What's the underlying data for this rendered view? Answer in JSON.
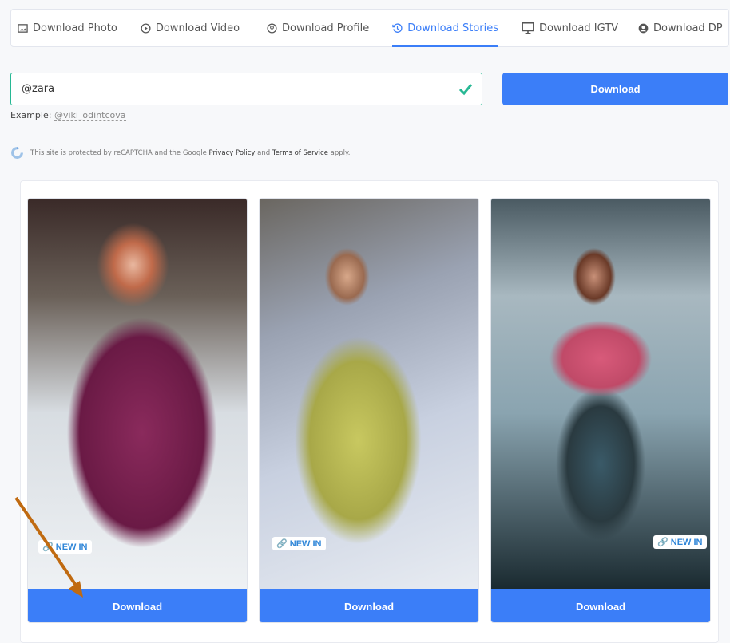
{
  "tabs": [
    {
      "label": "Download Photo",
      "icon": "image-icon",
      "active": false
    },
    {
      "label": "Download Video",
      "icon": "play-circle-icon",
      "active": false
    },
    {
      "label": "Download Profile",
      "icon": "user-circle-icon",
      "active": false
    },
    {
      "label": "Download Stories",
      "icon": "history-icon",
      "active": true
    },
    {
      "label": "Download IGTV",
      "icon": "monitor-icon",
      "active": false
    },
    {
      "label": "Download DP",
      "icon": "user-solid-icon",
      "active": false
    }
  ],
  "search": {
    "value": "@zara",
    "button": "Download",
    "example_label": "Example:",
    "example_value": "@viki_odintcova"
  },
  "captcha": {
    "text1": "This site is protected by reCAPTCHA and the Google",
    "privacy": "Privacy Policy",
    "and": "and",
    "terms": "Terms of Service",
    "apply": "apply."
  },
  "cards": [
    {
      "badge": "NEW IN",
      "button": "Download"
    },
    {
      "badge": "NEW IN",
      "button": "Download"
    },
    {
      "badge": "NEW IN",
      "button": "Download"
    }
  ],
  "colors": {
    "accent": "#3b7ef8",
    "valid": "#27b894",
    "arrow": "#c06a10"
  }
}
